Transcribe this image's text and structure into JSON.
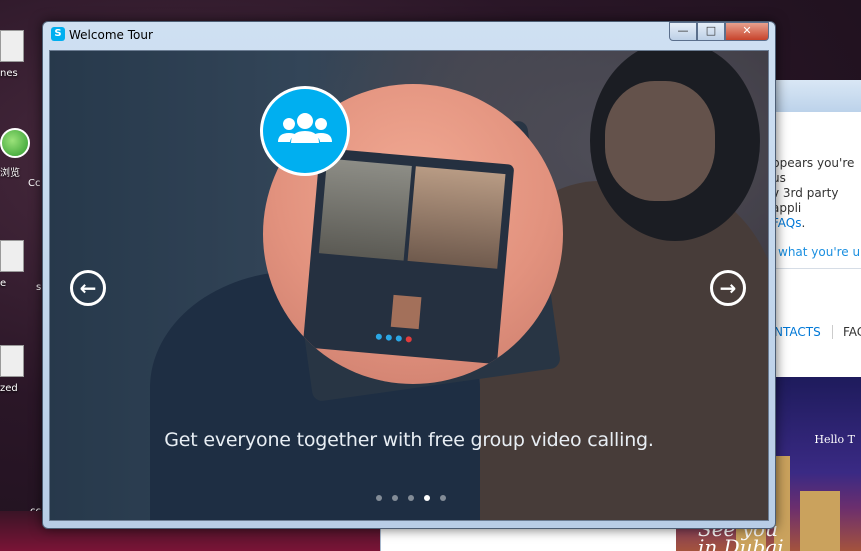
{
  "desktop": {
    "icons": [
      {
        "label": "nes"
      },
      {
        "label": "浏览"
      },
      {
        "label": "e"
      },
      {
        "label": "zed"
      }
    ],
    "extra_labels": [
      "Cc",
      "s",
      "cc"
    ]
  },
  "background_window": {
    "notice_line1": "ppears you're us",
    "notice_line2": "v 3rd party appli",
    "notice_link": "FAQs",
    "notice_suffix": ".",
    "search_text": "what you're up",
    "tab_contacts": "NTACTS",
    "tab_faq": "FAC",
    "ad": {
      "title": "Hello T",
      "city_line1": "See you",
      "city_line2": "in Dubai"
    }
  },
  "window": {
    "title": "Welcome Tour",
    "logo": "S",
    "controls": {
      "minimize": "—",
      "maximize": "□",
      "close": "✕"
    }
  },
  "tour": {
    "caption": "Get everyone together with free group video calling.",
    "prev_arrow": "←",
    "next_arrow": "→",
    "total_pages": 5,
    "active_page": 4,
    "feature_icon": "group-contacts-icon",
    "accent_color": "#00aff0"
  }
}
